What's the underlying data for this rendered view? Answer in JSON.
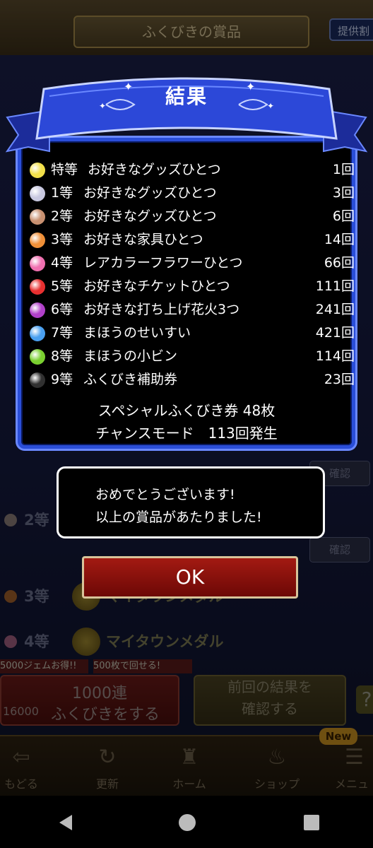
{
  "background": {
    "title": "ふくびきの賞品",
    "provide_button": "提供割",
    "prize_rows": [
      {
        "rank": "2等",
        "color": "#8a7d78"
      },
      {
        "rank": "3等",
        "color": "#a0602a",
        "prize": "マイタウンメダル"
      },
      {
        "rank": "4等",
        "color": "#a06080",
        "prize": "マイタウンメダル"
      }
    ],
    "confirm_label": "確認",
    "gem_tag": "5000ジェムお得!!",
    "tag_500": "500枚で回せる!",
    "draw_button": {
      "line1": "1000連",
      "line2": "ふくびきをする",
      "cost": "16000"
    },
    "prev_button": {
      "line1": "前回の結果を",
      "line2": "確認する"
    },
    "help_icon": "?"
  },
  "bottom_nav": {
    "items": [
      {
        "label": "もどる",
        "icon": "back-arrow-icon",
        "glyph": "⇦"
      },
      {
        "label": "更新",
        "icon": "refresh-icon",
        "glyph": "↻"
      },
      {
        "label": "ホーム",
        "icon": "home-dragon-icon",
        "glyph": "♜"
      },
      {
        "label": "ショップ",
        "icon": "shop-slime-icon",
        "glyph": "♨"
      },
      {
        "label": "メニュ",
        "icon": "menu-icon",
        "glyph": "☰"
      }
    ],
    "new_badge": "New"
  },
  "result": {
    "title": "結果",
    "prizes": [
      {
        "rank": "特等",
        "name": "お好きなグッズひとつ",
        "count": "1回",
        "color": "#f2e04a"
      },
      {
        "rank": "1等",
        "name": "お好きなグッズひとつ",
        "count": "3回",
        "color": "#c8c8e0"
      },
      {
        "rank": "2等",
        "name": "お好きなグッズひとつ",
        "count": "6回",
        "color": "#c89070"
      },
      {
        "rank": "3等",
        "name": "お好きな家具ひとつ",
        "count": "14回",
        "color": "#f09038"
      },
      {
        "rank": "4等",
        "name": "レアカラーフラワーひとつ",
        "count": "66回",
        "color": "#f070b0"
      },
      {
        "rank": "5等",
        "name": "お好きなチケットひとつ",
        "count": "111回",
        "color": "#e83030"
      },
      {
        "rank": "6等",
        "name": "お好きな打ち上げ花火3つ",
        "count": "241回",
        "color": "#b040c8"
      },
      {
        "rank": "7等",
        "name": "まほうのせいすい",
        "count": "421回",
        "color": "#4aa0f0"
      },
      {
        "rank": "8等",
        "name": "まほうの小ビン",
        "count": "114回",
        "color": "#7ad030"
      },
      {
        "rank": "9等",
        "name": "ふくびき補助券",
        "count": "23回",
        "color": "#303030"
      }
    ],
    "special_ticket": "スペシャルふくびき券 48枚",
    "chance_mode": "チャンスモード　113回発生"
  },
  "message": {
    "line1": "おめでとうございます!",
    "line2": "以上の賞品があたりました!"
  },
  "ok_button": "OK"
}
